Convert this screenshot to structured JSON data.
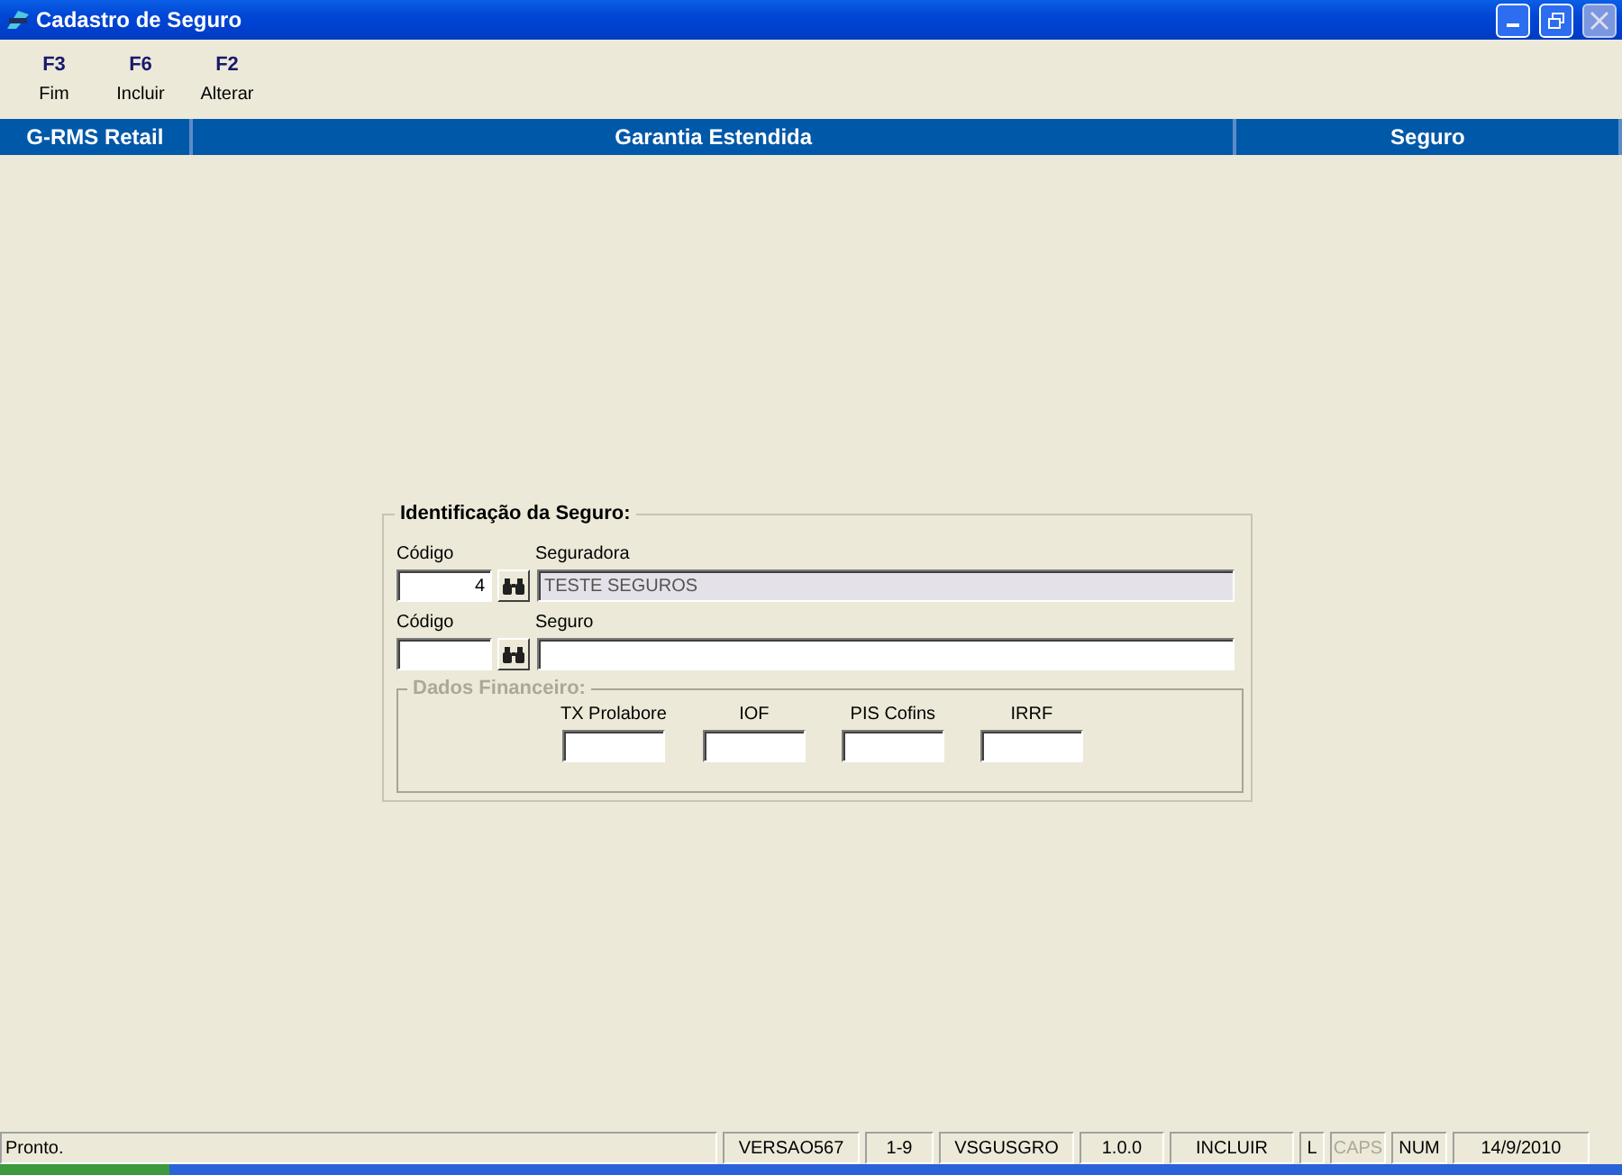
{
  "window": {
    "title": "Cadastro de Seguro"
  },
  "toolbar": [
    {
      "key": "F3",
      "label": "Fim"
    },
    {
      "key": "F6",
      "label": "Incluir"
    },
    {
      "key": "F2",
      "label": "Alterar"
    }
  ],
  "header": [
    "G-RMS Retail",
    "Garantia Estendida",
    "Seguro"
  ],
  "group": {
    "title": "Identificação da Seguro:",
    "rows": [
      {
        "code_label": "Código",
        "code_value": "4",
        "name_label": "Seguradora",
        "name_value": "TESTE SEGUROS",
        "disabled": true
      },
      {
        "code_label": "Código",
        "code_value": "",
        "name_label": "Seguro",
        "name_value": "",
        "disabled": false
      }
    ],
    "financial": {
      "title": "Dados Financeiro:",
      "disabled": true,
      "fields": [
        {
          "label": "TX Prolabore"
        },
        {
          "label": "IOF"
        },
        {
          "label": "PIS Cofins"
        },
        {
          "label": "IRRF"
        }
      ]
    }
  },
  "status_bar": {
    "message": "Pronto.",
    "panels": [
      {
        "text": "VERSAO567",
        "enabled": true
      },
      {
        "text": "1-9",
        "enabled": true
      },
      {
        "text": "VSGUSGRO",
        "enabled": true
      },
      {
        "text": "1.0.0",
        "enabled": true
      },
      {
        "text": "INCLUIR",
        "enabled": true
      },
      {
        "text": "L",
        "enabled": true
      },
      {
        "text": "CAPS",
        "enabled": false
      },
      {
        "text": "NUM",
        "enabled": true
      },
      {
        "text": "14/9/2010",
        "enabled": true
      }
    ]
  }
}
